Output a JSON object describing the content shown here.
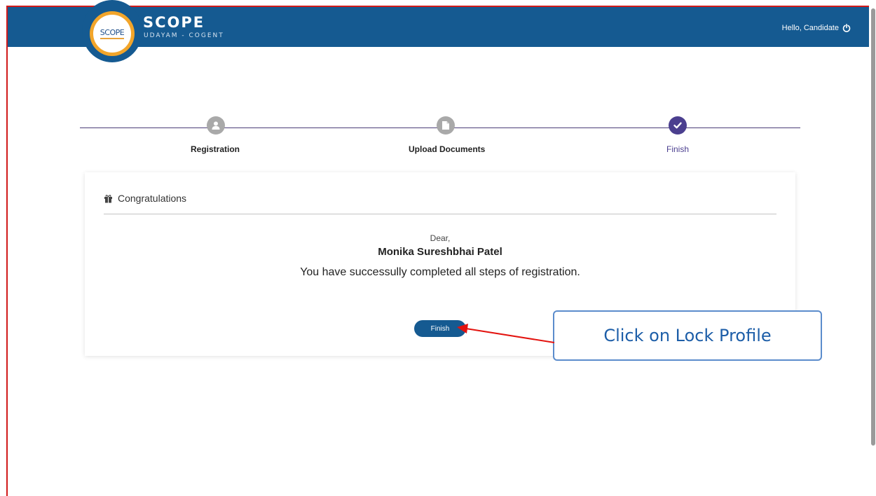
{
  "header": {
    "logo_text": "SCOPE",
    "brand_title": "SCOPE",
    "brand_subtitle": "UDAYAM - COGENT",
    "user_greeting": "Hello, Candidate",
    "logout_icon": "power-icon"
  },
  "steps": [
    {
      "label": "Registration",
      "icon": "user-icon",
      "state": "completed"
    },
    {
      "label": "Upload Documents",
      "icon": "file-icon",
      "state": "completed"
    },
    {
      "label": "Finish",
      "icon": "check-icon",
      "state": "active"
    }
  ],
  "card": {
    "title": "Congratulations",
    "title_icon": "gift-icon",
    "salutation": "Dear,",
    "candidate_name": "Monika Sureshbhai Patel",
    "message": "You have successully completed all steps of registration.",
    "finish_button": "Finish"
  },
  "annotation": {
    "callout_text": "Click on Lock Profile"
  },
  "colors": {
    "header_bg": "#155a91",
    "logo_ring": "#f2a52a",
    "step_active": "#4b3f8f",
    "step_inactive": "#a9a9a9",
    "frame_red": "#d11a1a",
    "callout_border": "#5b8ccc"
  }
}
